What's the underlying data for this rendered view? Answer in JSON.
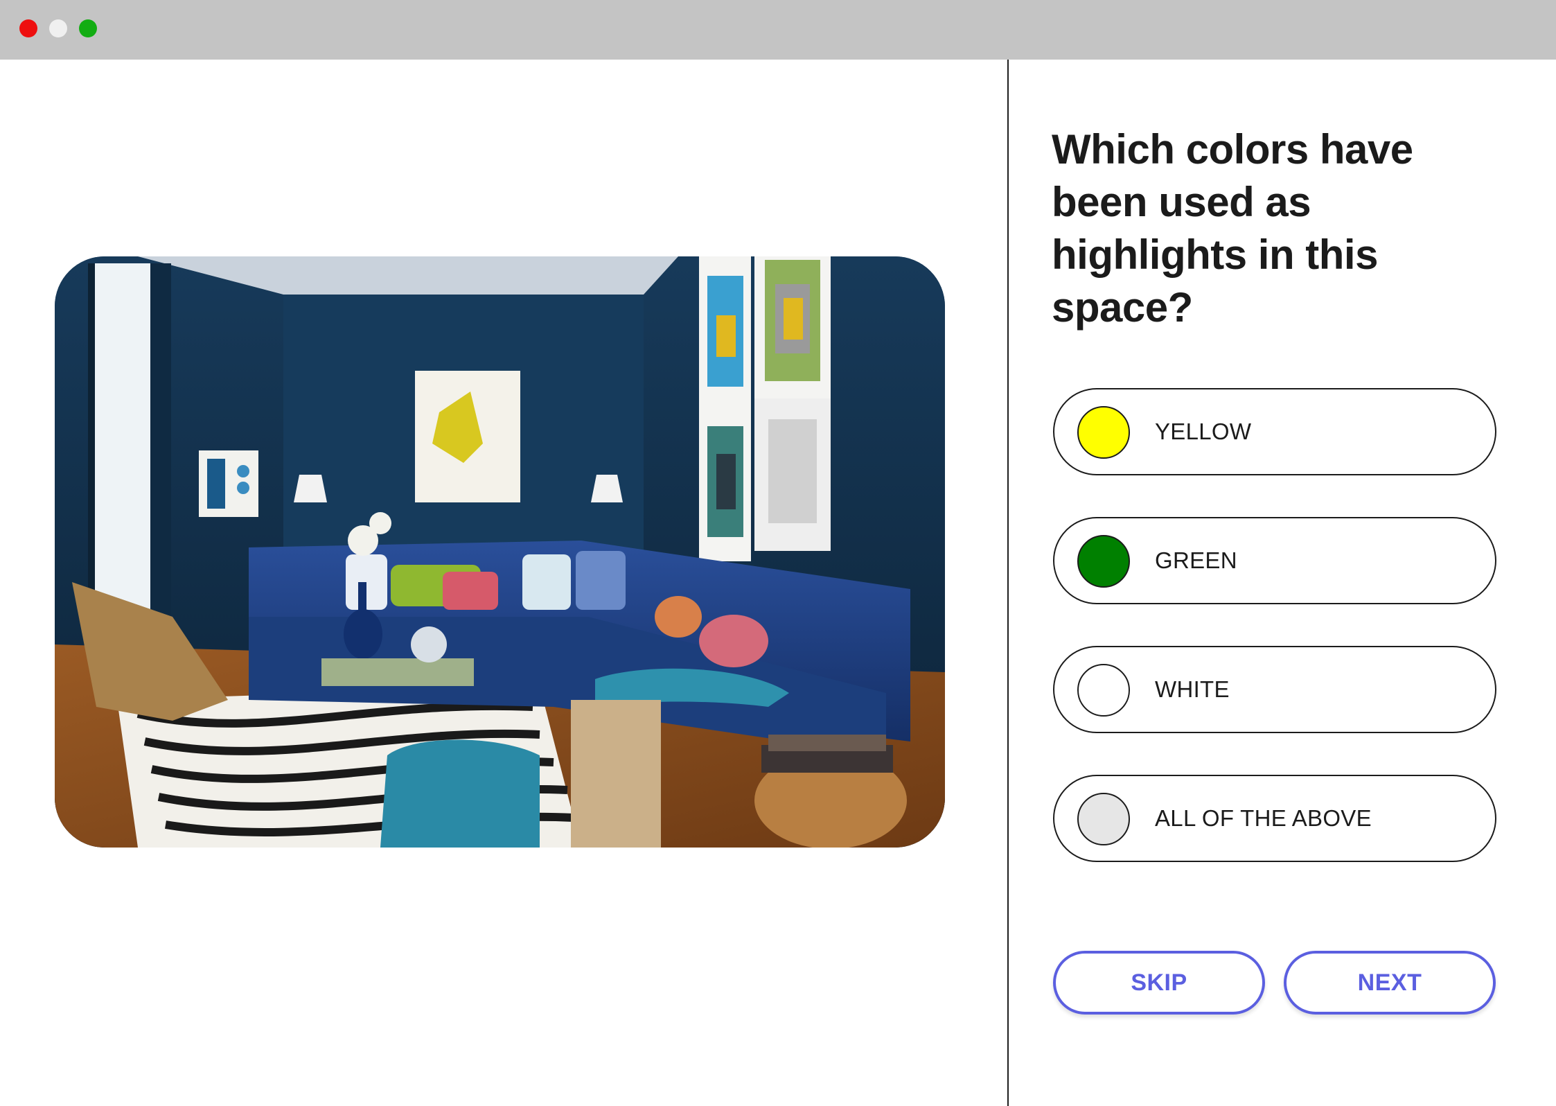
{
  "window": {
    "controls": [
      {
        "name": "close",
        "color": "#ee0f0f"
      },
      {
        "name": "minimize",
        "color": "#f0f0f0"
      },
      {
        "name": "maximize",
        "color": "#13ad13"
      }
    ]
  },
  "photo": {
    "subject": "living-room-photo"
  },
  "quiz": {
    "question": "Which colors have been used as highlights in this space?",
    "options": [
      {
        "label": "YELLOW",
        "swatch": "#ffff00"
      },
      {
        "label": "GREEN",
        "swatch": "#008000"
      },
      {
        "label": "WHITE",
        "swatch": "#ffffff"
      },
      {
        "label": "ALL OF THE ABOVE",
        "swatch": "#e6e6e6"
      }
    ],
    "skip_label": "SKIP",
    "next_label": "NEXT",
    "accent_color": "#5b5fe0"
  }
}
